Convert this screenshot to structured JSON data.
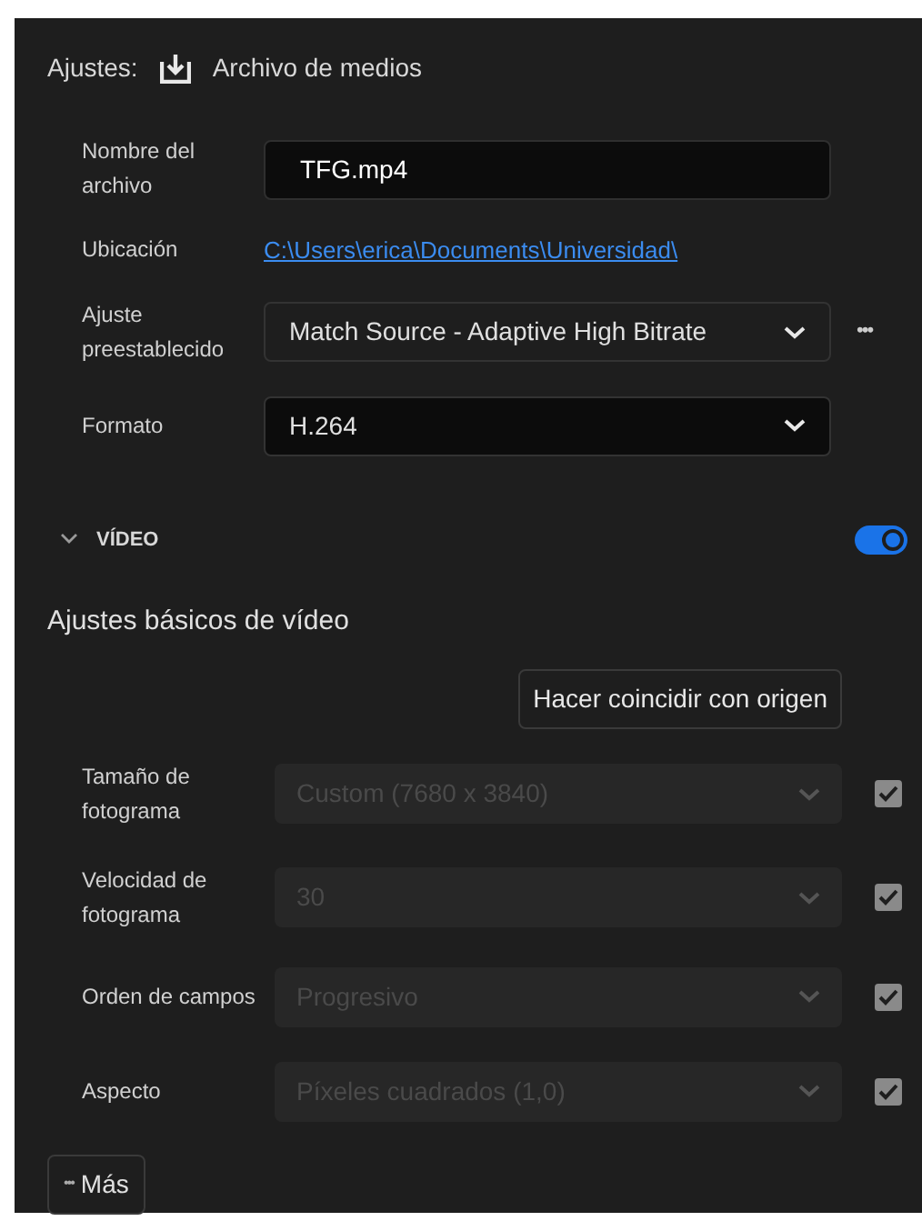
{
  "header": {
    "title": "Ajustes:",
    "subtitle": "Archivo de medios"
  },
  "fields": [
    {
      "kind": "text",
      "label": "Nombre del archivo",
      "value": "TFG.mp4"
    },
    {
      "kind": "link",
      "label": "Ubicación",
      "value": "C:\\Users\\erica\\Documents\\Universidad\\"
    },
    {
      "kind": "select",
      "label": "Ajuste preestablecido",
      "value": "Match Source - Adaptive High Bitrate",
      "more": "•••"
    },
    {
      "kind": "select-dark",
      "label": "Formato",
      "value": "H.264"
    }
  ],
  "video": {
    "title": "VÍDEO",
    "expanded": true,
    "on": true,
    "subtitle": "Ajustes básicos de vídeo",
    "match_button": "Hacer coincidir con origen",
    "rows": [
      {
        "label": "Tamaño de fotograma",
        "value": "Custom (7680 x 3840)",
        "disabled": true,
        "checked": true
      },
      {
        "label": "Velocidad de fotograma",
        "value": "30",
        "disabled": true,
        "checked": true
      },
      {
        "label": "Orden de campos",
        "value": "Progresivo",
        "disabled": true,
        "checked": true
      },
      {
        "label": "Aspecto",
        "value": "Píxeles cuadrados (1,0)",
        "disabled": true,
        "checked": true
      }
    ],
    "more_button": {
      "dots": "•••",
      "label": "Más"
    }
  }
}
